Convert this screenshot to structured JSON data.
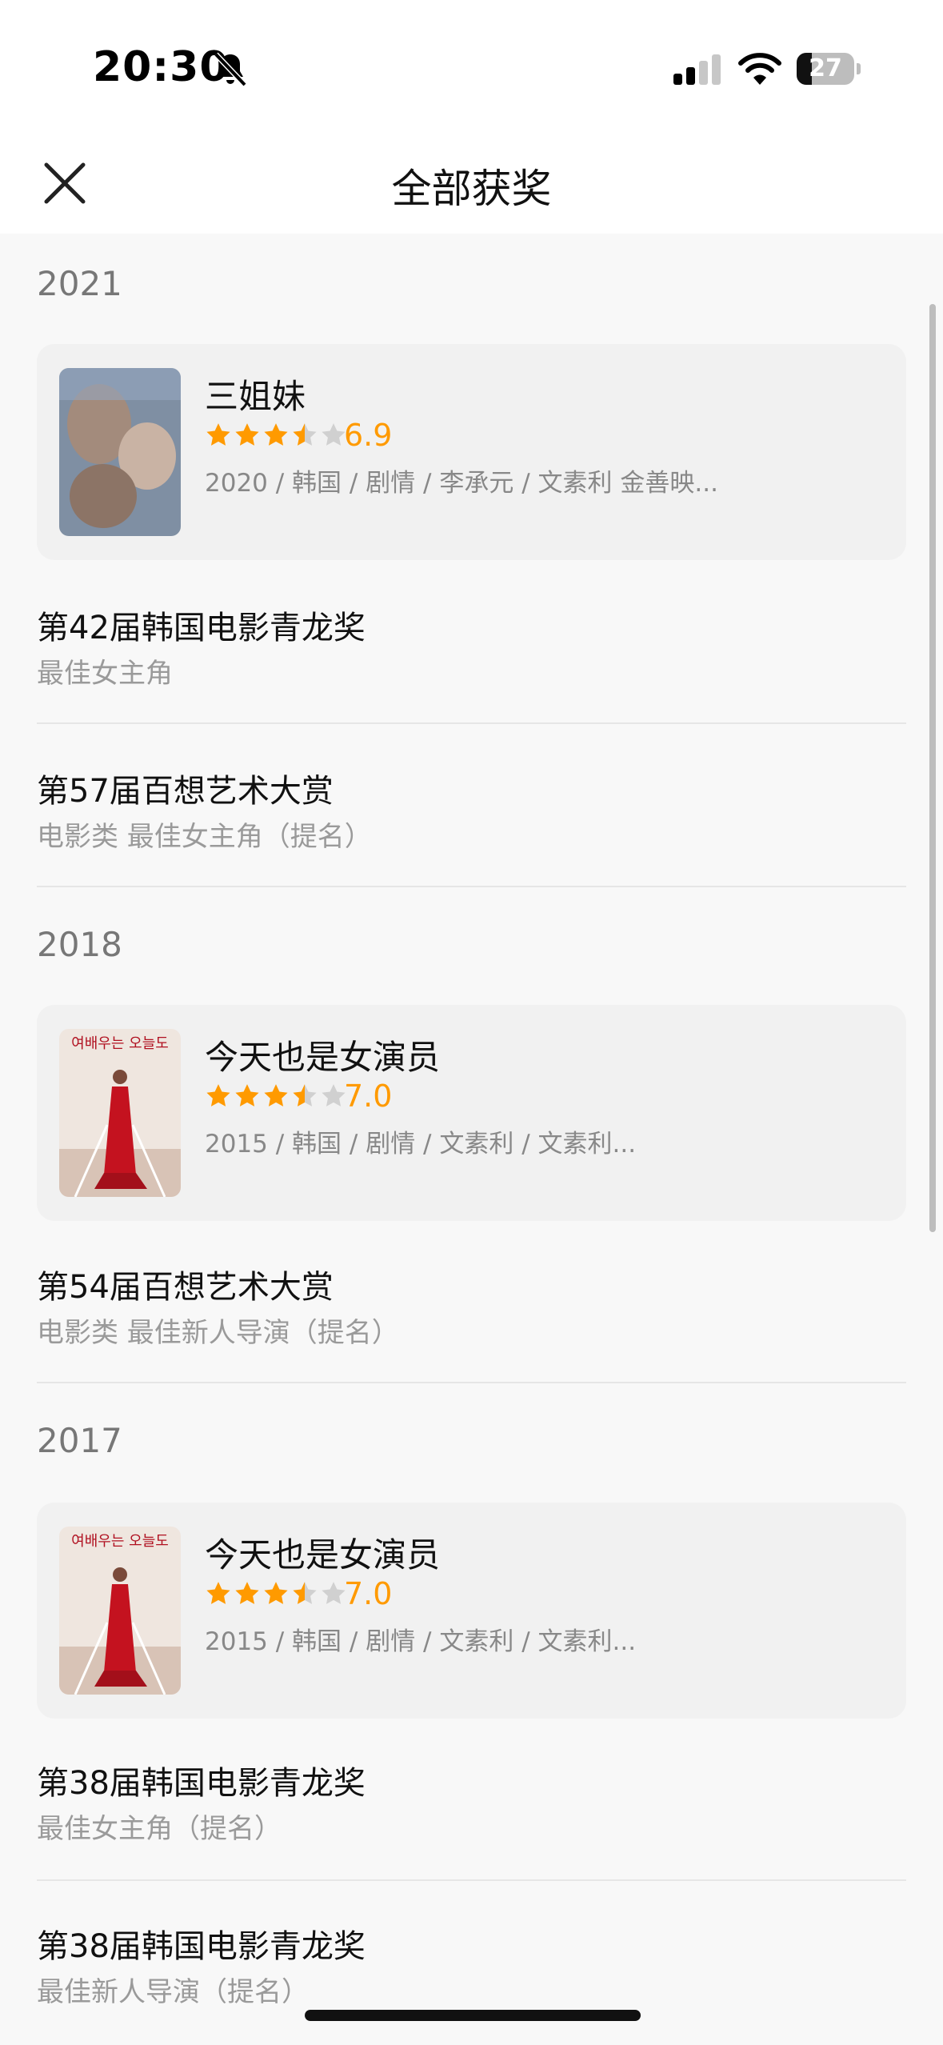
{
  "status_bar": {
    "time": "20:30",
    "battery": "27",
    "battery_level": 0.27
  },
  "header": {
    "title": "全部获奖"
  },
  "sections": [
    {
      "year": "2021",
      "movie": {
        "title": "三姐妹",
        "rating": "6.9",
        "stars": 3.5,
        "meta": "2020 / 韩国 / 剧情 / 李承元 / 文素利 金善映..."
      },
      "awards": [
        {
          "name": "第42届韩国电影青龙奖",
          "category": "最佳女主角"
        },
        {
          "name": "第57届百想艺术大赏",
          "category": "电影类 最佳女主角（提名）"
        }
      ]
    },
    {
      "year": "2018",
      "movie": {
        "title": "今天也是女演员",
        "rating": "7.0",
        "stars": 3.5,
        "meta": "2015 / 韩国 / 剧情 / 文素利 / 文素利..."
      },
      "awards": [
        {
          "name": "第54届百想艺术大赏",
          "category": "电影类 最佳新人导演（提名）"
        }
      ]
    },
    {
      "year": "2017",
      "movie": {
        "title": "今天也是女演员",
        "rating": "7.0",
        "stars": 3.5,
        "meta": "2015 / 韩国 / 剧情 / 文素利 / 文素利..."
      },
      "awards": [
        {
          "name": "第38届韩国电影青龙奖",
          "category": "最佳女主角（提名）"
        },
        {
          "name": "第38届韩国电影青龙奖",
          "category": "最佳新人导演（提名）"
        }
      ]
    }
  ],
  "colors": {
    "star": "#ff9a00",
    "star_empty": "#d0d0d0"
  }
}
